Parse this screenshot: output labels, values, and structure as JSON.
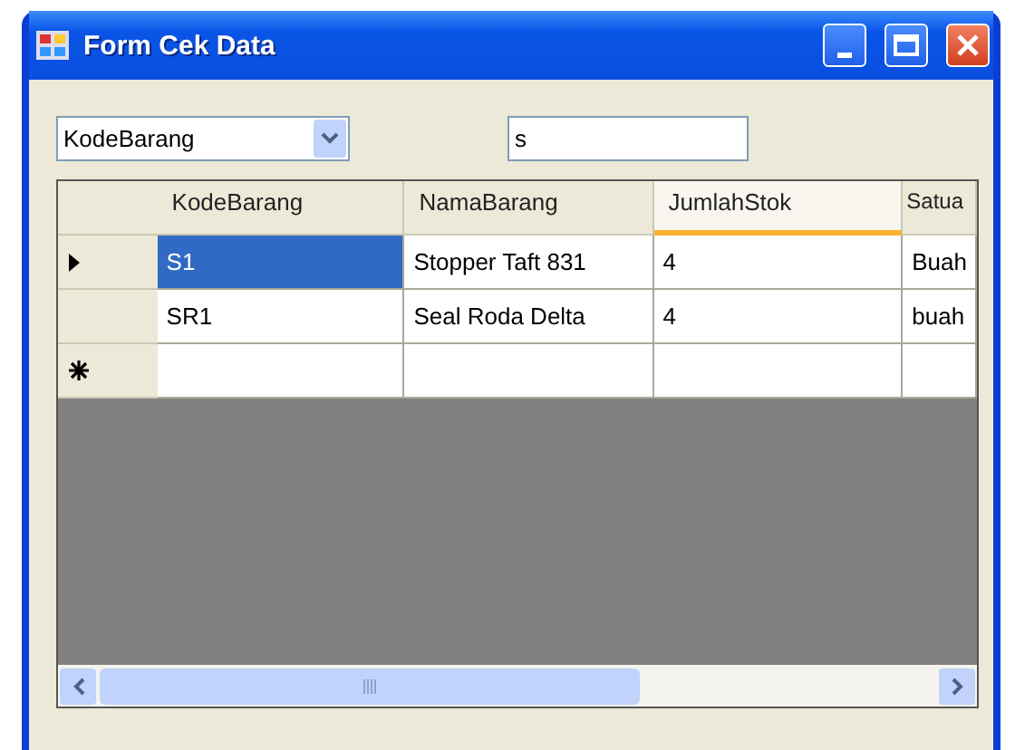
{
  "window": {
    "title": "Form Cek Data"
  },
  "filter": {
    "field": "KodeBarang",
    "search": "s"
  },
  "table": {
    "columns": [
      {
        "label": "KodeBarang",
        "hovered": false
      },
      {
        "label": "NamaBarang",
        "hovered": false
      },
      {
        "label": "JumlahStok",
        "hovered": true
      },
      {
        "label": "Satua",
        "hovered": false
      }
    ],
    "rows": [
      {
        "kind": "data",
        "current": true,
        "cells": [
          {
            "text": "S1",
            "selected": true
          },
          {
            "text": "Stopper Taft 831",
            "selected": false
          },
          {
            "text": "4",
            "selected": false
          },
          {
            "text": "Buah",
            "selected": false
          }
        ]
      },
      {
        "kind": "data",
        "current": false,
        "cells": [
          {
            "text": "SR1",
            "selected": false
          },
          {
            "text": "Seal Roda Delta",
            "selected": false
          },
          {
            "text": "4",
            "selected": false
          },
          {
            "text": "buah",
            "selected": false
          }
        ]
      },
      {
        "kind": "new",
        "cells": []
      }
    ]
  }
}
